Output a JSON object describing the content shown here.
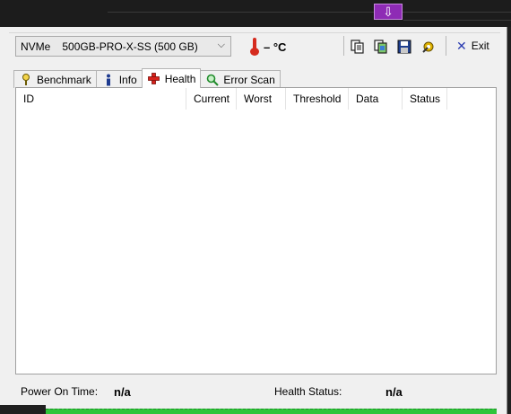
{
  "drive": {
    "type": "NVMe",
    "name": "500GB-PRO-X-SS (500 GB)"
  },
  "temperature": {
    "value": "– °C"
  },
  "toolbar": {
    "exit_label": "Exit"
  },
  "tabs": [
    {
      "label": "Benchmark",
      "icon": "benchmark-icon"
    },
    {
      "label": "Info",
      "icon": "info-icon"
    },
    {
      "label": "Health",
      "icon": "health-cross-icon"
    },
    {
      "label": "Error Scan",
      "icon": "magnifier-icon"
    }
  ],
  "table": {
    "columns": [
      "ID",
      "Current",
      "Worst",
      "Threshold",
      "Data",
      "Status"
    ],
    "rows": []
  },
  "status": {
    "power_on_label": "Power On Time:",
    "power_on_value": "n/a",
    "health_label": "Health Status:",
    "health_value": "n/a"
  },
  "colors": {
    "accent_button": "#8e2bb5",
    "progress": "#2fc53a",
    "thermometer": "#d52b1e"
  }
}
